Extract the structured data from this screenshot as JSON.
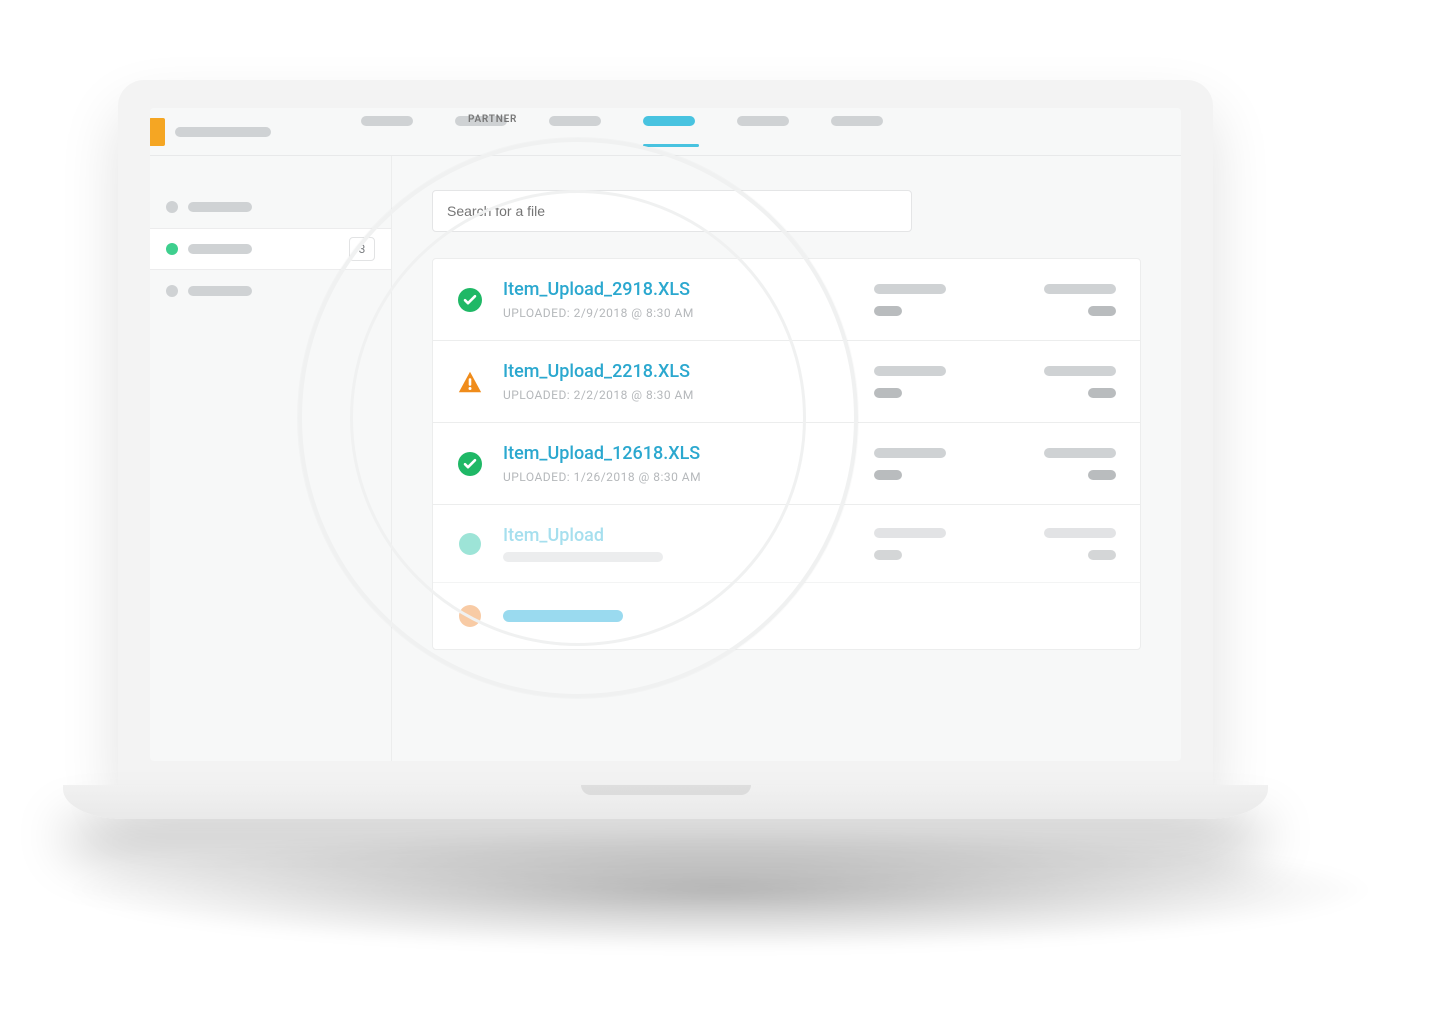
{
  "header": {
    "partner_label": "PARTNER"
  },
  "sidebar": {
    "items": [
      {
        "badge": ""
      },
      {
        "badge": "3",
        "selected": true
      },
      {
        "badge": ""
      }
    ]
  },
  "search": {
    "placeholder": "Search for a file"
  },
  "files": [
    {
      "status": "success",
      "name": "Item_Upload_2918.XLS",
      "meta": "UPLOADED: 2/9/2018 @ 8:30 AM"
    },
    {
      "status": "warning",
      "name": "Item_Upload_2218.XLS",
      "meta": "UPLOADED: 2/2/2018 @ 8:30 AM"
    },
    {
      "status": "success",
      "name": "Item_Upload_12618.XLS",
      "meta": "UPLOADED: 1/26/2018 @ 8:30 AM"
    },
    {
      "status": "processing",
      "name": "Item_Upload",
      "meta": ""
    },
    {
      "status": "pending",
      "name": "",
      "meta": ""
    }
  ],
  "colors": {
    "accent": "#48c3e0",
    "success": "#1fb866",
    "warning": "#f08c1b"
  }
}
